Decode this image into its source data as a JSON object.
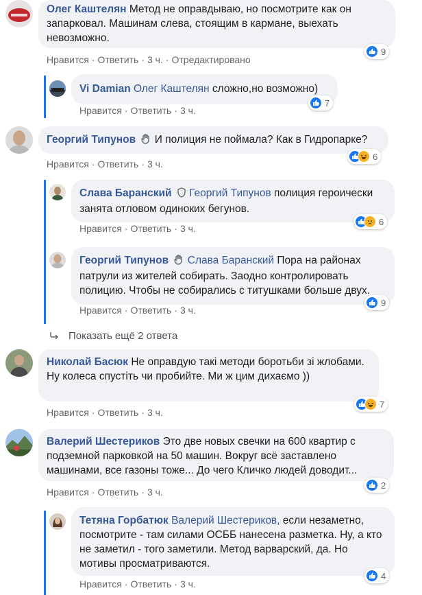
{
  "comments": [
    {
      "author": "Олег Каштелян",
      "text": "Метод не оправдываю, но посмотрите как он запарковал. Машинам слева, стоящим в кармане, выехать невозможно.",
      "like": "Нравится",
      "reply": "Ответить",
      "time": "3 ч.",
      "edited": "Отредактировано",
      "reactions": "9"
    },
    {
      "author": "Vi Damian",
      "mention": "Олег Каштелян",
      "text": "сложно,но возможно)",
      "like": "Нравится",
      "reply": "Ответить",
      "time": "3 ч.",
      "reactions": "7"
    },
    {
      "author": "Георгий Типунов",
      "text": "И полиция не поймала? Как в Гидропарке?",
      "like": "Нравится",
      "reply": "Ответить",
      "time": "3 ч.",
      "reactions": "6"
    },
    {
      "author": "Слава Баранский",
      "mention": "Георгий Типунов",
      "text": "полиция героически занята отловом одиноких бегунов.",
      "like": "Нравится",
      "reply": "Ответить",
      "time": "3 ч.",
      "reactions": "6"
    },
    {
      "author": "Георгий Типунов",
      "mention": "Слава Баранский",
      "text": "Пора на районах патрули из жителей собирать. Заодно контролировать полицию. Чтобы не собирались с титушками больше двух.",
      "like": "Нравится",
      "reply": "Ответить",
      "time": "3 ч.",
      "reactions": "9"
    },
    {
      "author": "Николай Басюк",
      "text": "Не оправдую такі методи боротьби зі жлобами. Ну колеса спустіть чи пробийте. Ми ж цим дихаємо ))",
      "like": "Нравится",
      "reply": "Ответить",
      "time": "3 ч.",
      "reactions": "7"
    },
    {
      "author": "Валерий Шестериков",
      "text": "Это две новых свечки на 600 квартир с подземной парковкой на 50 машин. Вокруг всё заставлено машинами, все газоны тоже... До чего Кличко людей доводит...",
      "like": "Нравится",
      "reply": "Ответить",
      "time": "3 ч.",
      "reactions": "2"
    },
    {
      "author": "Тетяна Горбатюк",
      "mention": "Валерий Шестериков,",
      "text": "если незаметно, посмотрите - там силами ОСББ нанесена разметка. Ну, а кто не заметил - того заметили. Метод варварский, да. Но мотивы просматриваются.",
      "like": "Нравится",
      "reply": "Ответить",
      "time": "3 ч.",
      "reactions": "4"
    }
  ],
  "show_more": "Показать ещё 2 ответа",
  "colors": {
    "link": "#385898",
    "bubble": "#f0f2f5",
    "like": "#1877f2",
    "thread": "#1877f2"
  },
  "icons": [
    "like-icon",
    "haha-icon",
    "sad-icon",
    "wave-badge-icon",
    "shield-badge-icon",
    "reply-arrow-icon"
  ]
}
